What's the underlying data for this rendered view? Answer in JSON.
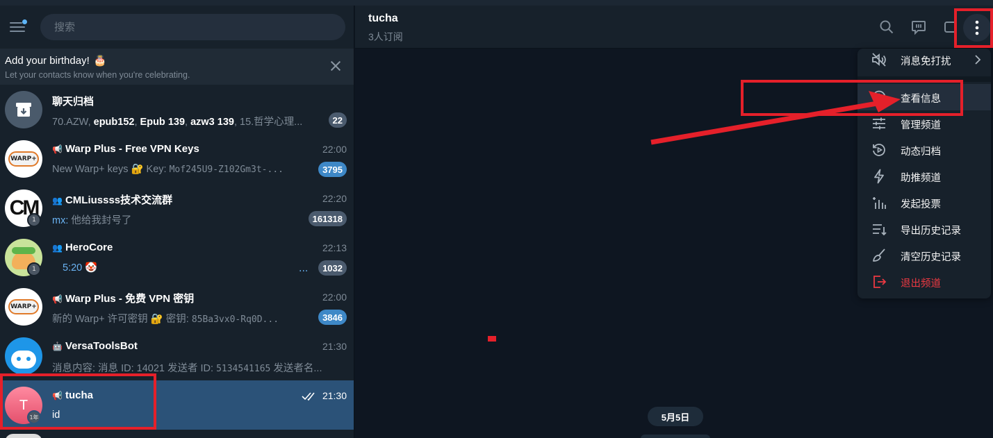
{
  "sidebar": {
    "search_placeholder": "搜索",
    "birthday": {
      "title": "Add your birthday!",
      "subtitle": "Let your contacts know when you're celebrating."
    },
    "chats": [
      {
        "name": "聊天归档",
        "time": "",
        "preview_parts": [
          "70.AZW, ",
          "epub152",
          ", ",
          "Epub 139",
          ", ",
          "azw3 139",
          ", 15.哲学心理..."
        ],
        "badge": "22"
      },
      {
        "name": "Warp Plus - Free VPN Keys",
        "time": "22:00",
        "preview_a": "New Warp+ keys 🔐 Key: ",
        "preview_b": "Mof245U9-Z102Gm3t-...",
        "badge": "3795"
      },
      {
        "name": "CMLiussss技术交流群",
        "time": "22:20",
        "sender": "mx:",
        "preview_a": " 他给我封号了",
        "badge": "161318",
        "mini": "1"
      },
      {
        "name": "HeroCore",
        "time": "22:13",
        "preview_a": "5:20 🤡",
        "preview_b": "...",
        "badge": "1032",
        "mini": "1"
      },
      {
        "name": "Warp Plus - 免费 VPN 密钥",
        "time": "22:00",
        "preview_a": "新的 Warp+ 许可密钥 🔐 密钥: ",
        "preview_b": "85Ba3vx0-Rq0D...",
        "badge": "3846"
      },
      {
        "name": "VersaToolsBot",
        "time": "21:30",
        "preview_a": "消息内容: 消息 ID: 14021 发送者 ID: ",
        "preview_b": "5134541165",
        "preview_c": " 发送者名..."
      },
      {
        "name": "tucha",
        "time": "21:30",
        "preview_a": "id",
        "avatar_letter": "T",
        "mini": "1年"
      }
    ]
  },
  "channel": {
    "title": "tucha",
    "subtitle": "3人订阅",
    "date_label": "5月5日"
  },
  "menu": {
    "items": [
      {
        "label": "消息免打扰",
        "icon": "mute-icon"
      },
      {
        "label": "查看信息",
        "icon": "info-icon"
      },
      {
        "label": "管理频道",
        "icon": "settings-sliders-icon"
      },
      {
        "label": "动态归档",
        "icon": "stories-archive-icon"
      },
      {
        "label": "助推频道",
        "icon": "boost-icon"
      },
      {
        "label": "发起投票",
        "icon": "poll-icon"
      },
      {
        "label": "导出历史记录",
        "icon": "export-icon"
      },
      {
        "label": "清空历史记录",
        "icon": "broom-icon"
      },
      {
        "label": "退出频道",
        "icon": "leave-icon"
      }
    ]
  },
  "colors": {
    "bg": "#0e1621",
    "panel": "#17212b",
    "selected": "#2b5278",
    "accent": "#5eb5f7",
    "danger": "#ec3942",
    "annotation_red": "#e5202a"
  }
}
